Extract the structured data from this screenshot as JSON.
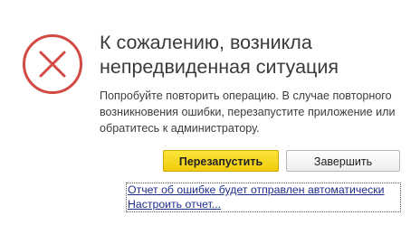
{
  "dialog": {
    "title_lines": [
      "К сожалению, возникла",
      "непредвиденная ситуация"
    ],
    "message_lines": [
      "Попробуйте повторить операцию. В случае повторного",
      "возникновения ошибки, перезапустите приложение или",
      "обратитесь к администратору."
    ],
    "icon": "error-circle-x",
    "colors": {
      "icon_red": "#d24a43",
      "primary_button": "#f7d81f",
      "link": "#1f2e8c"
    }
  },
  "buttons": {
    "restart_label": "Перезапустить",
    "finish_label": "Завершить"
  },
  "links": {
    "report_notice": "Отчет об ошибке будет отправлен автоматически",
    "configure_report": "Настроить отчет..."
  }
}
